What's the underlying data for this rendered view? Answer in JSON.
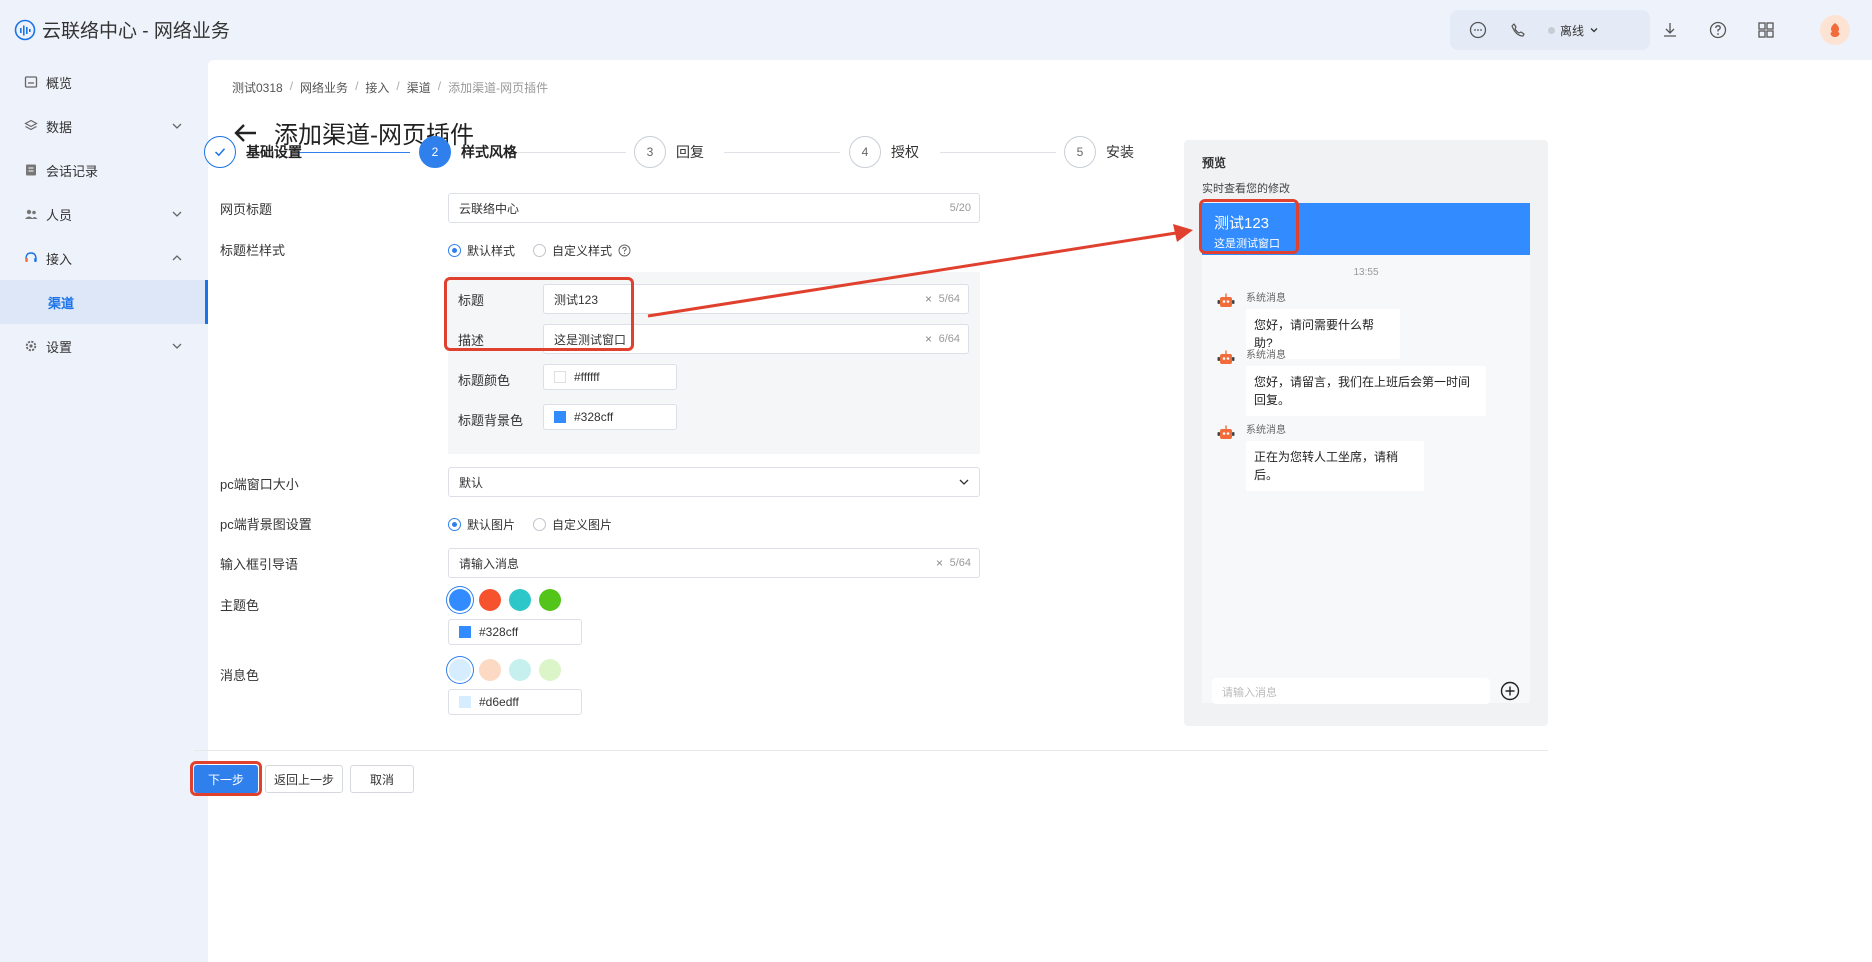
{
  "app": {
    "title": "云联络中心 - 网络业务"
  },
  "topbar": {
    "status": "离线",
    "icons": [
      "chat-icon",
      "phone-icon",
      "download-icon",
      "help-icon",
      "grid-icon",
      "avatar"
    ]
  },
  "sidebar": {
    "items": [
      {
        "label": "概览",
        "icon": "overview-icon"
      },
      {
        "label": "数据",
        "icon": "data-icon",
        "expandable": true
      },
      {
        "label": "会话记录",
        "icon": "record-icon"
      },
      {
        "label": "人员",
        "icon": "people-icon",
        "expandable": true
      },
      {
        "label": "接入",
        "icon": "access-icon",
        "expanded": true
      },
      {
        "label": "渠道",
        "sub": true,
        "active": true
      },
      {
        "label": "设置",
        "icon": "settings-icon",
        "expandable": true
      }
    ]
  },
  "breadcrumb": [
    "测试0318",
    "网络业务",
    "接入",
    "渠道",
    "添加渠道-网页插件"
  ],
  "page_title": "添加渠道-网页插件",
  "steps": [
    {
      "num": "",
      "label": "基础设置",
      "state": "done"
    },
    {
      "num": "2",
      "label": "样式风格",
      "state": "active"
    },
    {
      "num": "3",
      "label": "回复",
      "state": "todo"
    },
    {
      "num": "4",
      "label": "授权",
      "state": "todo"
    },
    {
      "num": "5",
      "label": "安装",
      "state": "todo"
    }
  ],
  "form": {
    "page_title_label": "网页标题",
    "page_title_value": "云联络中心",
    "page_title_count": "5/20",
    "titlebar_style_label": "标题栏样式",
    "titlebar_style_options": [
      "默认样式",
      "自定义样式"
    ],
    "sub": {
      "title_label": "标题",
      "title_value": "测试123",
      "title_count": "5/64",
      "desc_label": "描述",
      "desc_value": "这是测试窗口",
      "desc_count": "6/64",
      "title_color_label": "标题颜色",
      "title_color_value": "#ffffff",
      "title_bg_label": "标题背景色",
      "title_bg_value": "#328cff"
    },
    "pc_size_label": "pc端窗口大小",
    "pc_size_value": "默认",
    "pc_bg_label": "pc端背景图设置",
    "pc_bg_options": [
      "默认图片",
      "自定义图片"
    ],
    "input_guide_label": "输入框引导语",
    "input_guide_value": "请输入消息",
    "input_guide_count": "5/64",
    "theme_label": "主题色",
    "theme_colors": [
      "#328cff",
      "#f5522d",
      "#2ec7c9",
      "#52c41a"
    ],
    "theme_value": "#328cff",
    "msg_label": "消息色",
    "msg_colors": [
      "#d6edff",
      "#fcd9c2",
      "#c6f0ee",
      "#dcf5c8"
    ],
    "msg_value": "#d6edff"
  },
  "preview": {
    "title": "预览",
    "subtitle": "实时查看您的修改",
    "header_title": "测试123",
    "header_desc": "这是测试窗口",
    "time": "13:55",
    "sender": "系统消息",
    "messages": [
      "您好，请问需要什么帮助?",
      "您好，请留言，我们在上班后会第一时间回复。",
      "正在为您转人工坐席，请稍后。"
    ],
    "input_placeholder": "请输入消息"
  },
  "footer": {
    "next": "下一步",
    "back": "返回上一步",
    "cancel": "取消"
  },
  "colors": {
    "accent": "#2f80ed",
    "highlight": "#e0412e"
  }
}
